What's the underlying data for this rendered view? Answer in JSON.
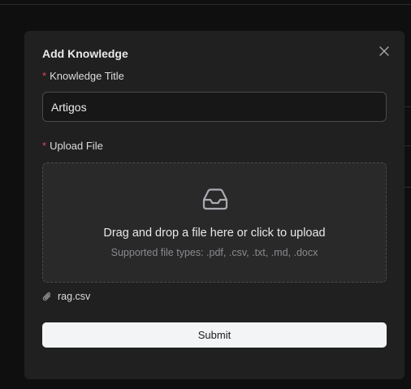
{
  "modal": {
    "title": "Add Knowledge",
    "close_icon": "close-icon"
  },
  "knowledge_title": {
    "required_mark": "*",
    "label": "Knowledge Title",
    "value": "Artigos"
  },
  "upload_file": {
    "required_mark": "*",
    "label": "Upload File",
    "icon": "inbox-icon",
    "instruction": "Drag and drop a file here or click to upload",
    "supported_types": "Supported file types: .pdf, .csv, .txt, .md, .docx"
  },
  "attachment": {
    "icon": "paperclip-icon",
    "file_name": "rag.csv"
  },
  "submit_label": "Submit",
  "colors": {
    "page_background": "#0f0f10",
    "modal_background": "#202021",
    "required": "#e0445a",
    "submit_background": "#f3f4f6"
  }
}
